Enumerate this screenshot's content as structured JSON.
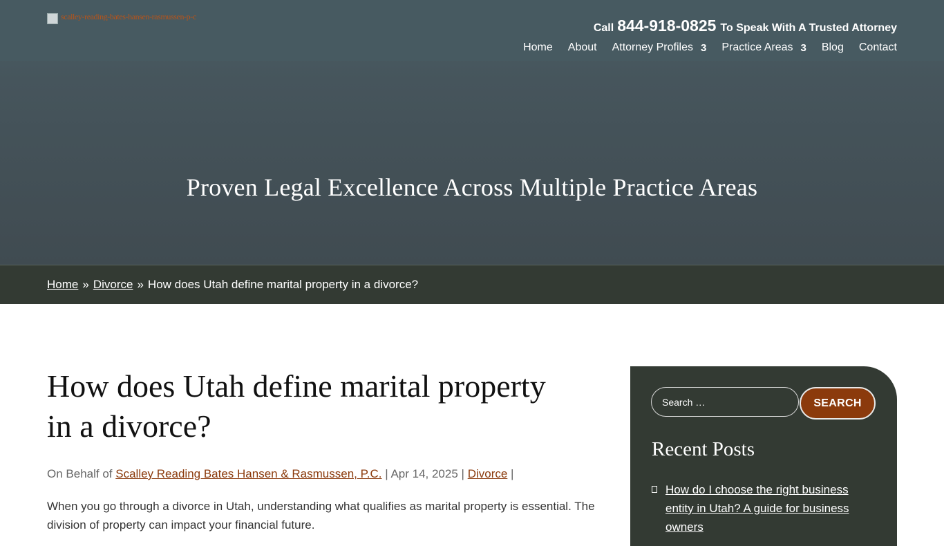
{
  "header": {
    "logo_alt": "scalley-reading-bates-hansen-rasmussen-p-c",
    "call_prefix": "Call",
    "phone": "844-918-0825",
    "call_suffix": "To Speak With A Trusted Attorney",
    "nav": [
      {
        "label": "Home"
      },
      {
        "label": "About"
      },
      {
        "label": "Attorney Profiles",
        "caret": "3"
      },
      {
        "label": "Practice Areas",
        "caret": "3"
      },
      {
        "label": "Blog"
      },
      {
        "label": "Contact"
      }
    ]
  },
  "hero": {
    "title": "Proven Legal Excellence Across Multiple Practice Areas"
  },
  "breadcrumb": {
    "home": "Home",
    "separator": "»",
    "category": "Divorce",
    "current": "How does Utah define marital property in a divorce?"
  },
  "article": {
    "title": "How does Utah define marital property in a divorce?",
    "meta_prefix": "On Behalf of",
    "author": "Scalley Reading Bates Hansen & Rasmussen, P.C.",
    "date": "Apr 14, 2025",
    "category": "Divorce",
    "intro": "When you go through a divorce in Utah, understanding what qualifies as marital property is essential. The division of property can impact your financial future."
  },
  "sidebar": {
    "search_placeholder": "Search …",
    "search_button": "SEARCH",
    "recent_title": "Recent Posts",
    "recent_posts": [
      {
        "title": "How do I choose the right business entity in Utah? A guide for business owners"
      }
    ]
  },
  "colors": {
    "accent": "#8b3a0c",
    "dark_panel": "#333a33",
    "hero": "#46555c"
  }
}
